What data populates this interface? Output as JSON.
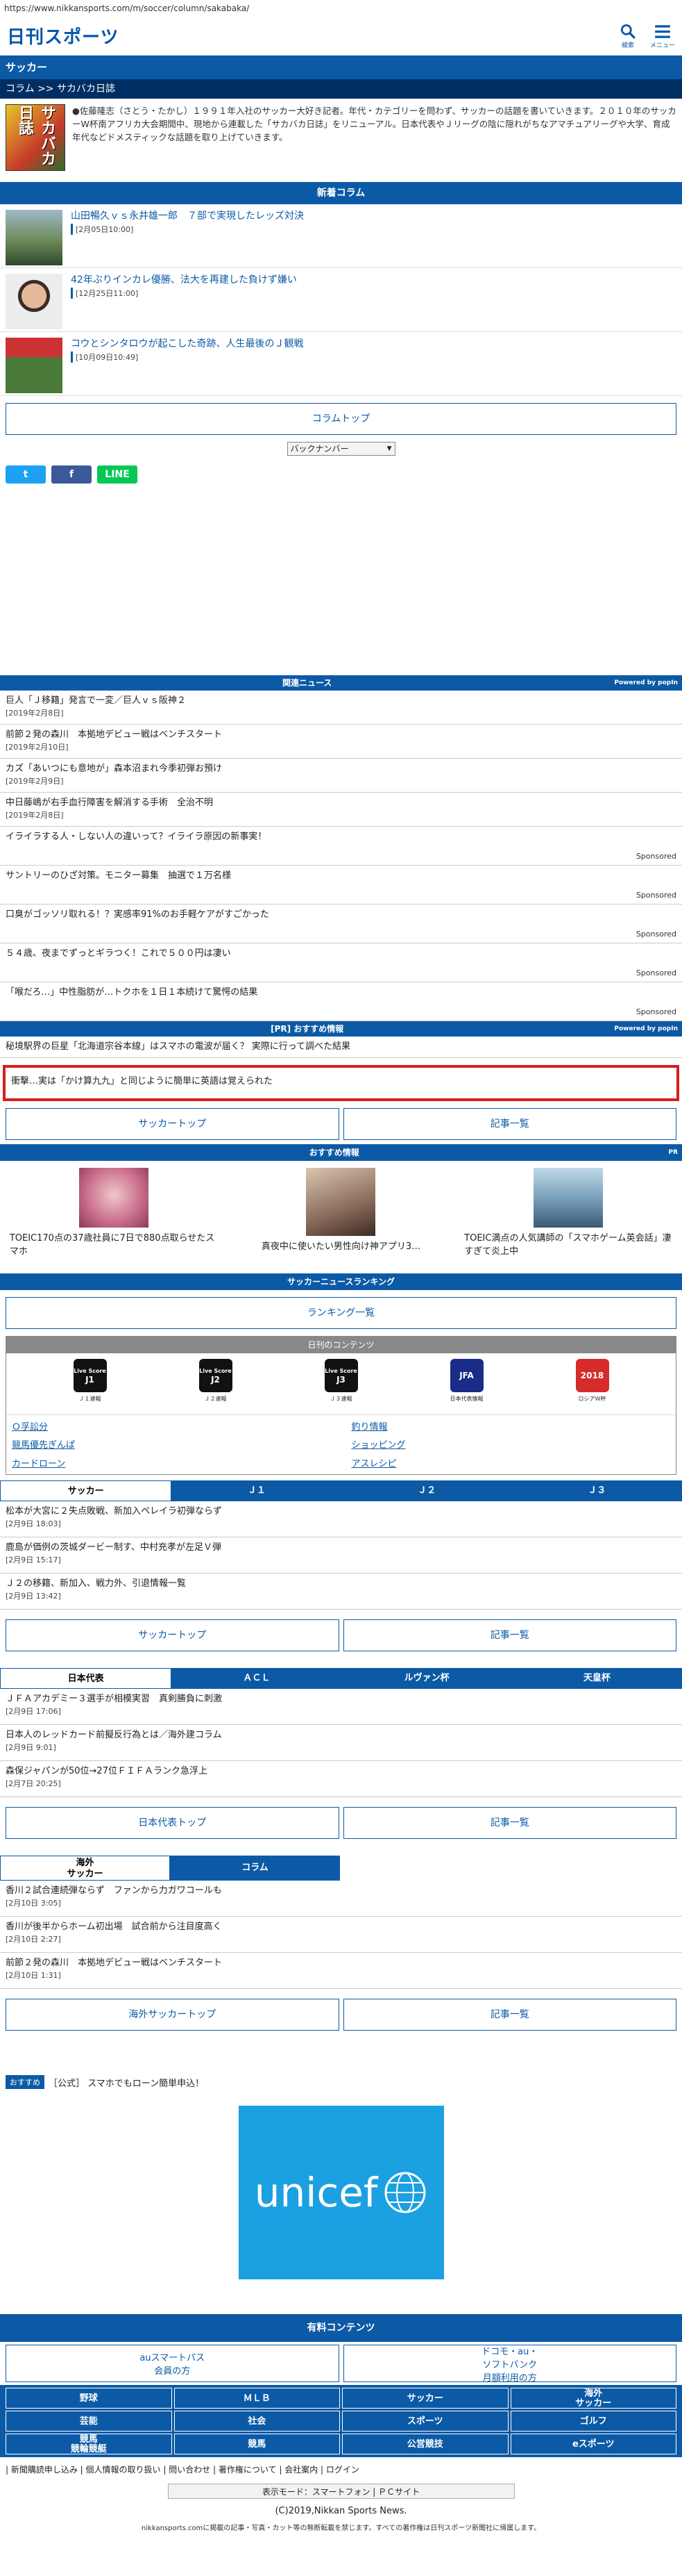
{
  "browser": {
    "url": "https://www.nikkansports.com/m/soccer/column/sakabaka/"
  },
  "header": {
    "logo": "日刊スポーツ",
    "search_label": "検索",
    "menu_label": "メニュー"
  },
  "section": {
    "title": "サッカー",
    "breadcrumb": "コラム >> サカバカ日誌"
  },
  "intro": {
    "thumb": "サカバカ日誌",
    "text": "●佐藤隆志（さとう・たかし）１９９１年入社のサッカー大好き記者。年代・カテゴリーを問わず、サッカーの話題を書いていきます。２０１０年のサッカーW杯南アフリカ大会期間中、現地から連載した「サカバカ日誌」をリニューアル。日本代表やＪリーグの陰に隠れがちなアマチュアリーグや大学、育成年代などドメスティックな話題を取り上げていきます。"
  },
  "new_column": {
    "heading": "新着コラム",
    "items": [
      {
        "title": "山田暢久ｖｓ永井雄一郎　７部で実現したレッズ対決",
        "date": "[2月05日10:00]"
      },
      {
        "title": "42年ぶりインカレ優勝、法大を再建した負けず嫌い",
        "date": "[12月25日11:00]"
      },
      {
        "title": "コウとシンタロウが起こした奇跡、人生最後のＪ観戦",
        "date": "[10月09日10:49]"
      }
    ],
    "top_button": "コラムトップ",
    "backnumber": "バックナンバー"
  },
  "share": {
    "twitter": "t",
    "facebook": "f",
    "line": "LINE"
  },
  "related": {
    "heading": "関連ニュース",
    "powered": "Powered by popIn",
    "items": [
      {
        "title": "巨人「Ｊ移籍」発言で一変／巨人ｖｓ阪神２",
        "date": "[2019年2月8日]"
      },
      {
        "title": "前節２発の森川　本拠地デビュー戦はベンチスタート",
        "date": "[2019年2月10日]"
      },
      {
        "title": "カズ「あいつにも意地が」森本沼まれ今季初弾お預け",
        "date": "[2019年2月9日]"
      },
      {
        "title": "中日藤嶋が右手血行障害を解消する手術　全治不明",
        "date": "[2019年2月8日]"
      }
    ],
    "sponsored": [
      {
        "title": "イライラする人・しない人の違いって？イライラ原因の新事実！",
        "tag": "Sponsored"
      },
      {
        "title": "サントリーのひざ対策。モニター募集　抽選で１万名様",
        "tag": "Sponsored"
      },
      {
        "title": "口臭がゴッソリ取れる！？実感率91%のお手軽ケアがすごかった",
        "tag": "Sponsored"
      },
      {
        "title": "５４歳、夜までずっとギラつく！これで５００円は凄い",
        "tag": "Sponsored"
      },
      {
        "title": "「喉だろ…」中性脂肪が…トクホを１日１本続けて驚愕の結果",
        "tag": "Sponsored"
      }
    ]
  },
  "pr": {
    "heading": "[PR] おすすめ情報",
    "powered": "Powered by popIn",
    "item": "秘境駅界の巨星「北海道宗谷本線」はスマホの電波が届く？ 実際に行って調べた結果"
  },
  "red_box": "衝撃…実は「かけ算九九」と同じように簡単に英語は覚えられた",
  "nav1": {
    "left": "サッカートップ",
    "right": "記事一覧"
  },
  "recommend": {
    "heading": "おすすめ情報",
    "pr": "PR",
    "items": [
      {
        "title": "TOEIC170点の37歳社員に7日で880点取らせたスマホ"
      },
      {
        "title": "真夜中に使いたい男性向け神アプリ3…"
      },
      {
        "title": "TOEIC満点の人気講師の「スマホゲーム英会話」凄すぎて炎上中"
      }
    ]
  },
  "ranking": {
    "heading": "サッカーニュースランキング",
    "button": "ランキング一覧"
  },
  "contents": {
    "heading": "日刊のコンテンツ",
    "icons": [
      {
        "label": "Ｊ１速報",
        "icon": "J1"
      },
      {
        "label": "Ｊ２速報",
        "icon": "J2"
      },
      {
        "label": "Ｊ３速報",
        "icon": "J3"
      },
      {
        "label": "日本代表情報",
        "icon": "JFA"
      },
      {
        "label": "ロシアＷ杯",
        "icon": "2018"
      }
    ],
    "links": [
      "Ｏ孚訟分",
      "釣り情報",
      "競馬優先ぎんぱ",
      "ショッピング",
      "カードローン",
      "アスレシピ"
    ]
  },
  "tabs1": {
    "tabs": [
      "サッカー",
      "Ｊ１",
      "Ｊ２",
      "Ｊ３"
    ],
    "items": [
      {
        "title": "松本が大宮に２失点敗戦、新加入ペレイラ初弾ならず",
        "date": "[2月9日 18:03]"
      },
      {
        "title": "鹿島が価例の茨城ダービー制す、中村充孝が左足Ｖ弾",
        "date": "[2月9日 15:17]"
      },
      {
        "title": "Ｊ２の移籍、新加入、戦力外、引退情報一覧",
        "date": "[2月9日 13:42]"
      }
    ],
    "left": "サッカートップ",
    "right": "記事一覧"
  },
  "tabs2": {
    "tabs": [
      "日本代表",
      "ＡＣＬ",
      "ルヴァン杯",
      "天皇杯"
    ],
    "items": [
      {
        "title": "ＪＦＡアカデミー３選手が相模実習　真剣勝負に刺激",
        "date": "[2月9日 17:06]"
      },
      {
        "title": "日本人のレッドカード前擬反行為とは／海外建コラム",
        "date": "[2月9日 9:01]"
      },
      {
        "title": "森保ジャパンが50位→27位ＦＩＦＡランク急浮上",
        "date": "[2月7日 20:25]"
      }
    ],
    "left": "日本代表トップ",
    "right": "記事一覧"
  },
  "tabs3": {
    "tabs": [
      "海外\nサッカー",
      "コラム"
    ],
    "items": [
      {
        "title": "香川２試合連続弾ならず　ファンから力ガワコールも",
        "date": "[2月10日 3:05]"
      },
      {
        "title": "香川が後半からホーム初出場　試合前から注目度高く",
        "date": "[2月10日 2:27]"
      },
      {
        "title": "前節２発の森川　本拠地デビュー戦はベンチスタート",
        "date": "[2月10日 1:31]"
      }
    ],
    "left": "海外サッカートップ",
    "right": "記事一覧"
  },
  "promo": {
    "badge": "おすすめ",
    "text": "［公式］ スマホでもローン簡単申込！"
  },
  "ad": {
    "text": "unicef"
  },
  "paid": {
    "heading": "有料コンテンツ",
    "left": "auスマートパス\n会員の方",
    "right": "ドコモ・au・\nソフトバンク\n月額利用の方"
  },
  "nav_grid": [
    "野球",
    "ＭＬＢ",
    "サッカー",
    "海外\nサッカー",
    "芸能",
    "社会",
    "スポーツ",
    "ゴルフ",
    "競馬\n競輪競艇",
    "競馬",
    "公営競技",
    "eスポーツ"
  ],
  "footer": {
    "links": "| 新聞購読申し込み | 個人情報の取り扱い | 問い合わせ | 著作権について | 会社案内 | ログイン",
    "display_mode": "表示モード：スマートフォン | ＰＣサイト",
    "copyright": "(C)2019,Nikkan Sports News.",
    "note": "nikkansports.comに掲載の記事・写真・カット等の無断転載を禁じます。すべての著作権は日刊スポーツ新聞社に帰属します。"
  }
}
